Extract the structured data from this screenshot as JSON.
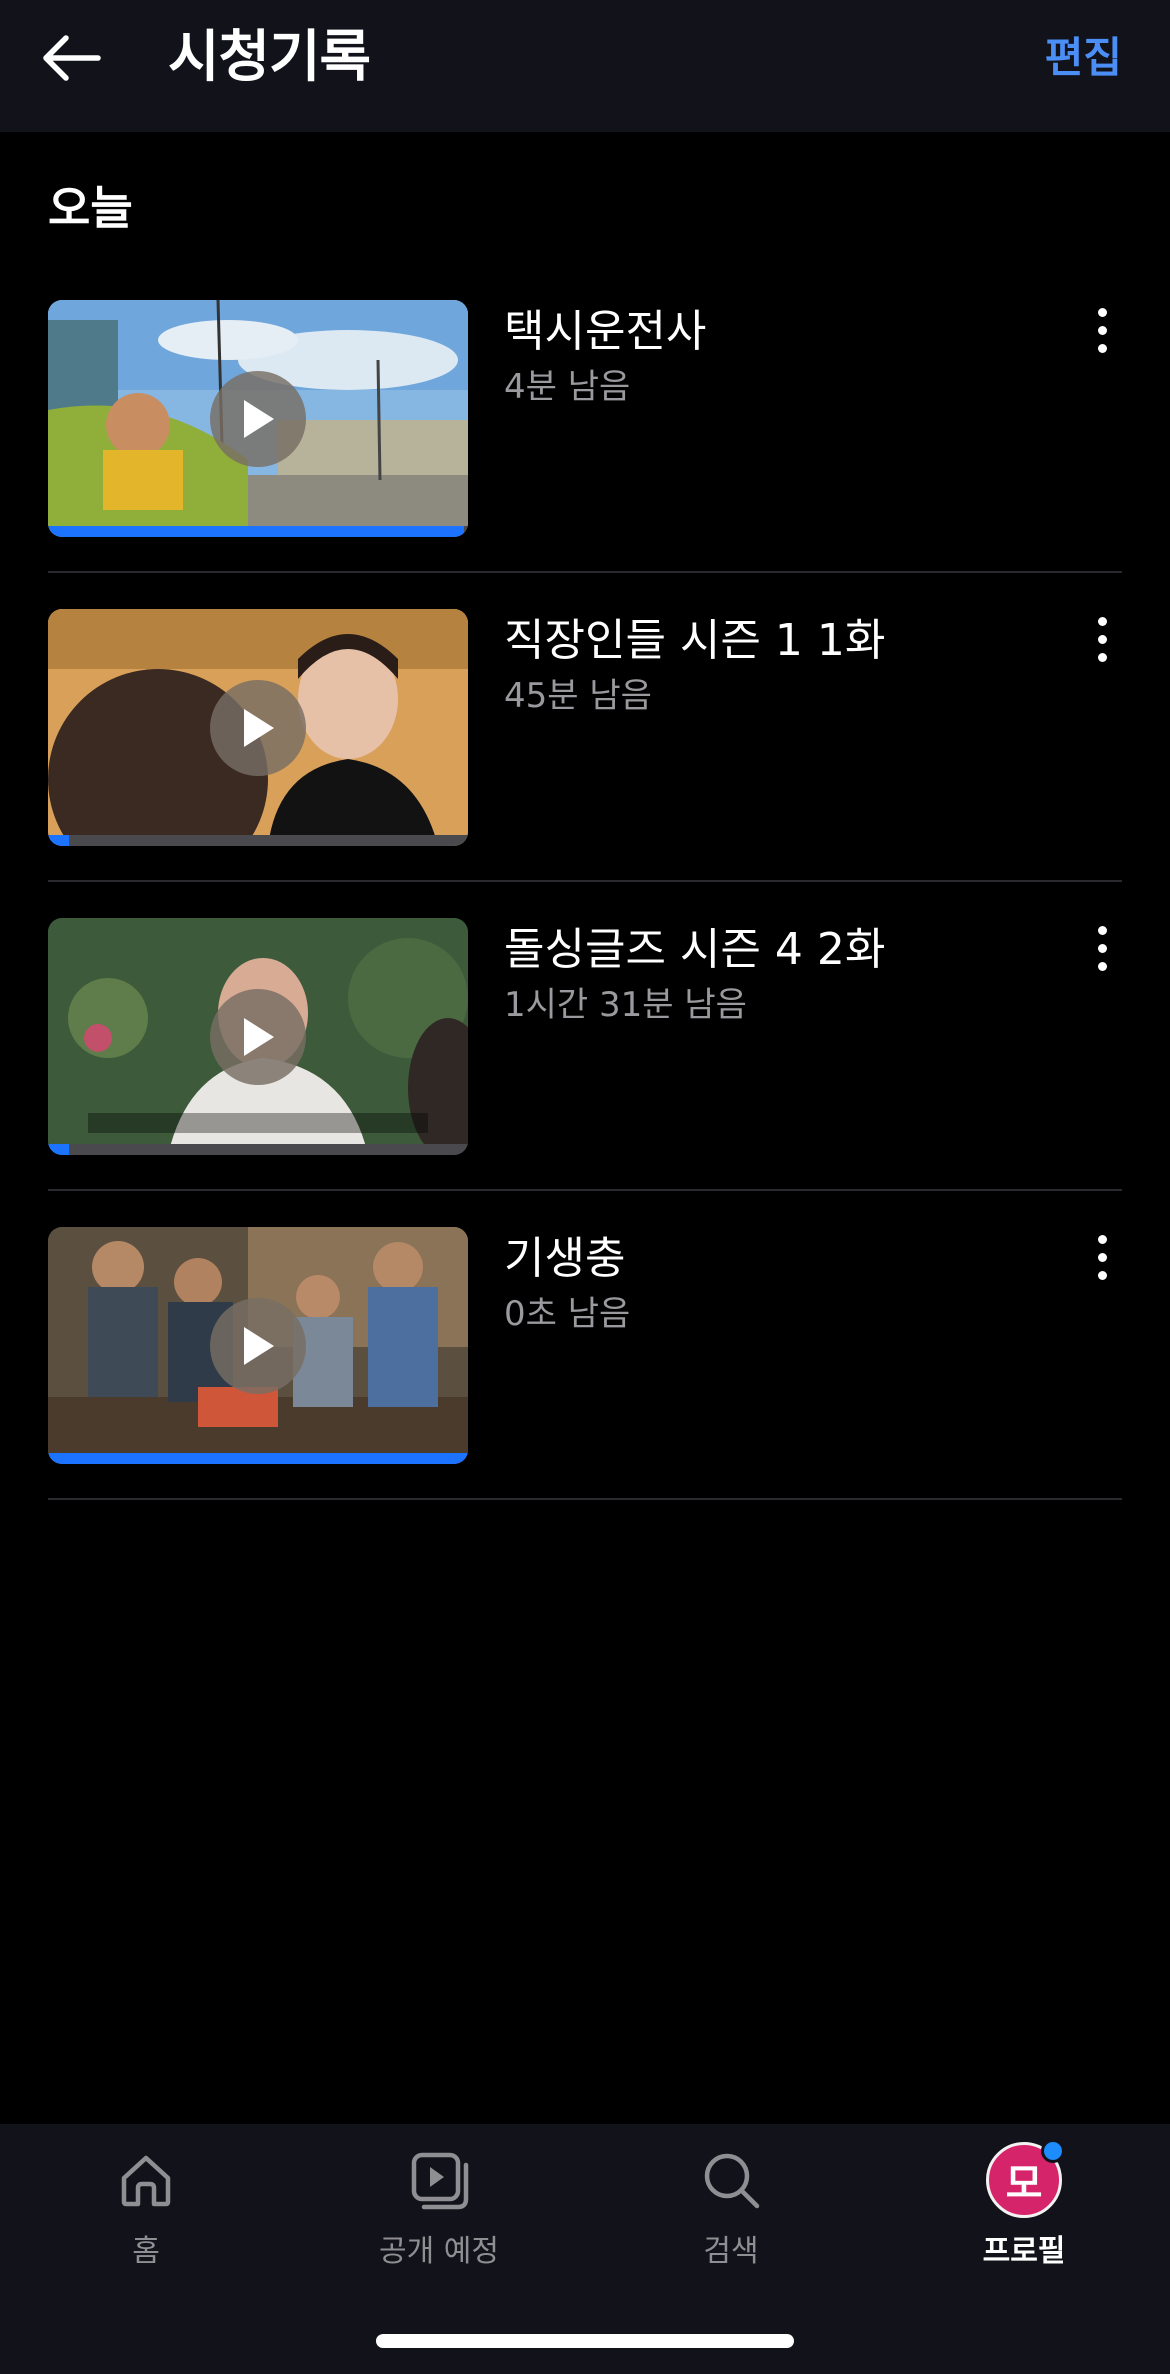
{
  "header": {
    "title": "시청기록",
    "edit_label": "편집"
  },
  "section": {
    "title": "오늘"
  },
  "items": [
    {
      "title": "택시운전사",
      "subtitle": "4분 남음",
      "progress": 0.99
    },
    {
      "title": "직장인들 시즌 1 1화",
      "subtitle": "45분 남음",
      "progress": 0.05
    },
    {
      "title": "돌싱글즈 시즌 4 2화",
      "subtitle": "1시간 31분 남음",
      "progress": 0.05
    },
    {
      "title": "기생충",
      "subtitle": "0초 남음",
      "progress": 1.0
    }
  ],
  "tabbar": {
    "tabs": [
      {
        "label": "홈",
        "icon": "home-icon"
      },
      {
        "label": "공개 예정",
        "icon": "upcoming-icon"
      },
      {
        "label": "검색",
        "icon": "search-icon"
      },
      {
        "label": "프로필",
        "icon": "avatar"
      }
    ],
    "avatar_letter": "모"
  },
  "colors": {
    "accent": "#4b8ef5",
    "progress": "#1c73ff",
    "avatar": "#d6246b",
    "badge": "#1c8cff"
  }
}
